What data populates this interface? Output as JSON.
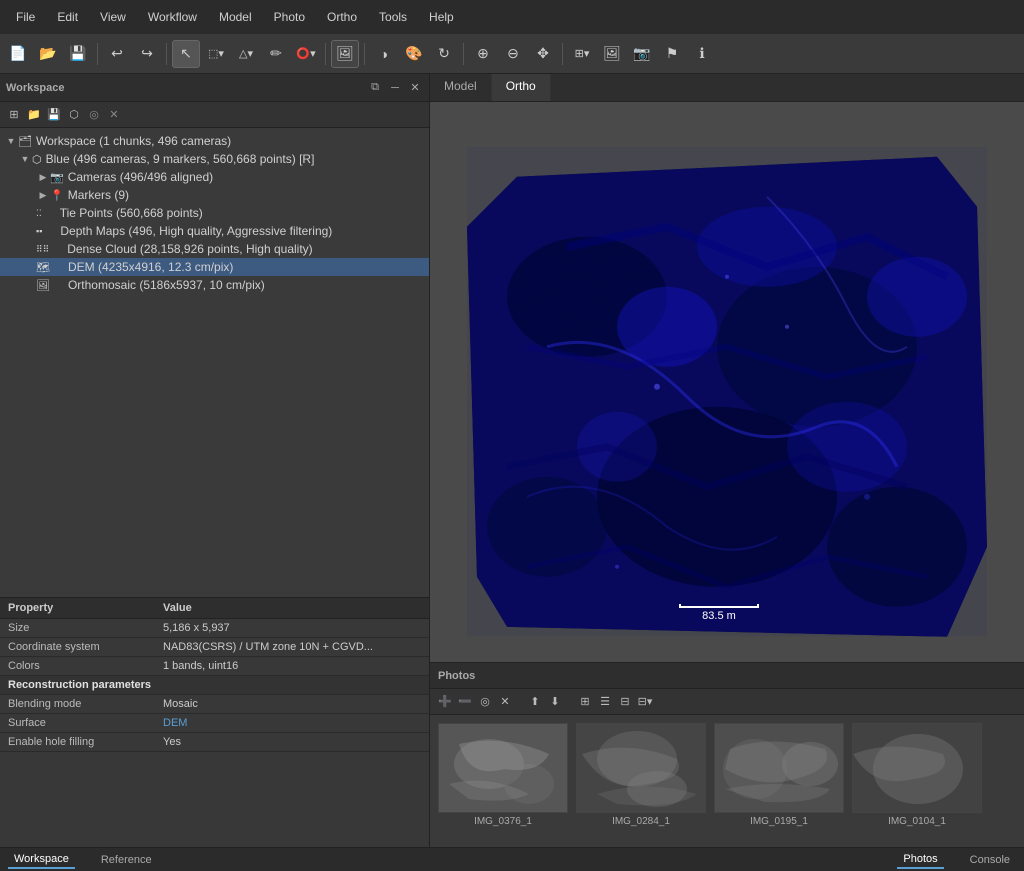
{
  "menubar": {
    "items": [
      "File",
      "Edit",
      "View",
      "Workflow",
      "Model",
      "Photo",
      "Ortho",
      "Tools",
      "Help"
    ]
  },
  "workspace": {
    "title": "Workspace",
    "header_text": "Workspace",
    "chunk_info": "Workspace (1 chunks, 496 cameras)",
    "tree": {
      "chunk_label": "Blue (496 cameras, 9 markers, 560,668 points) [R]",
      "cameras_label": "Cameras (496/496 aligned)",
      "markers_label": "Markers (9)",
      "tie_points_label": "Tie Points (560,668 points)",
      "depth_maps_label": "Depth Maps (496, High quality, Aggressive filtering)",
      "dense_cloud_label": "Dense Cloud (28,158,926 points, High quality)",
      "dem_label": "DEM (4235x4916, 12.3 cm/pix)",
      "ortho_label": "Orthomosaic (5186x5937, 10 cm/pix)"
    }
  },
  "view_tabs": {
    "model_label": "Model",
    "ortho_label": "Ortho"
  },
  "scale_bar": {
    "value": "83.5 m"
  },
  "properties": {
    "header_property": "Property",
    "header_value": "Value",
    "rows": [
      {
        "property": "Size",
        "value": "5,186 x 5,937"
      },
      {
        "property": "Coordinate system",
        "value": "NAD83(CSRS) / UTM zone 10N + CGVD..."
      },
      {
        "property": "Colors",
        "value": "1 bands, uint16"
      }
    ],
    "reconstruction_label": "Reconstruction parameters",
    "reconstruction_rows": [
      {
        "property": "Blending mode",
        "value": "Mosaic"
      },
      {
        "property": "Surface",
        "value": "DEM"
      },
      {
        "property": "Enable hole filling",
        "value": "Yes"
      }
    ]
  },
  "photos": {
    "title": "Photos",
    "items": [
      {
        "label": "IMG_0376_1"
      },
      {
        "label": "IMG_0284_1"
      },
      {
        "label": "IMG_0195_1"
      },
      {
        "label": "IMG_0104_1"
      }
    ]
  },
  "statusbar": {
    "workspace_tab": "Workspace",
    "reference_tab": "Reference",
    "photos_tab": "Photos",
    "console_tab": "Console"
  },
  "icons": {
    "new": "📄",
    "open": "📂",
    "save": "💾",
    "undo": "↩",
    "redo": "↪",
    "select": "↖",
    "rect": "⬚",
    "polygon": "△",
    "brush": "✏",
    "lasso": "⭕",
    "cursor": "▶",
    "palette": "🎨",
    "rotate": "↻",
    "zoom_in": "🔍",
    "zoom_out": "🔎",
    "pan": "✥",
    "fit": "⊞",
    "camera": "📷",
    "flag": "⚑",
    "expand": "▶",
    "folder": "📁",
    "chunk_icon": "⬡",
    "points": "⁚",
    "depth": "▪",
    "cloud": "⠿",
    "dem": "🗺",
    "ortho": "🖼"
  }
}
